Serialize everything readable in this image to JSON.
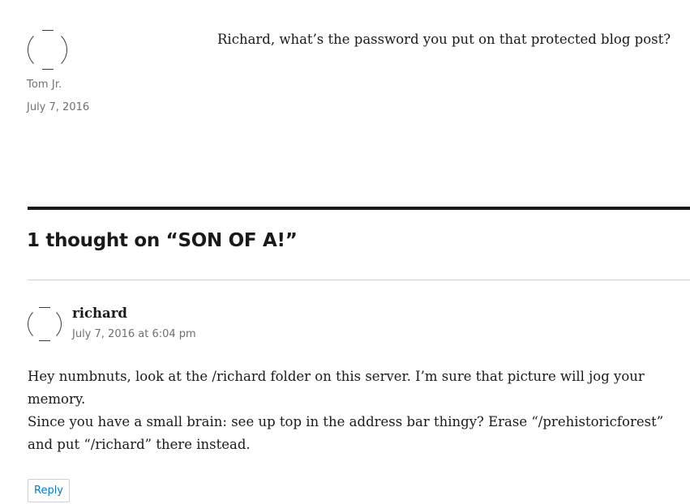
{
  "post": {
    "author": "Tom Jr.",
    "date": "July 7, 2016",
    "content": "Richard, what’s the password you put on that protected blog post?"
  },
  "comments_section": {
    "title": "1 thought on “SON OF A!”"
  },
  "comments": [
    {
      "author": "richard",
      "date": "July 7, 2016 at 6:04 pm",
      "paragraphs": [
        "Hey numbnuts, look at the /richard folder on this server. I’m sure that picture will jog your memory.",
        "Since you have a small brain: see up top in the address bar thingy? Erase “/prehistoricforest” and put “/richard” there instead."
      ],
      "reply_label": "Reply"
    }
  ],
  "colors": {
    "text": "#1a1a1a",
    "meta": "#707070",
    "link": "#007acc",
    "border": "#d1d1d1"
  }
}
